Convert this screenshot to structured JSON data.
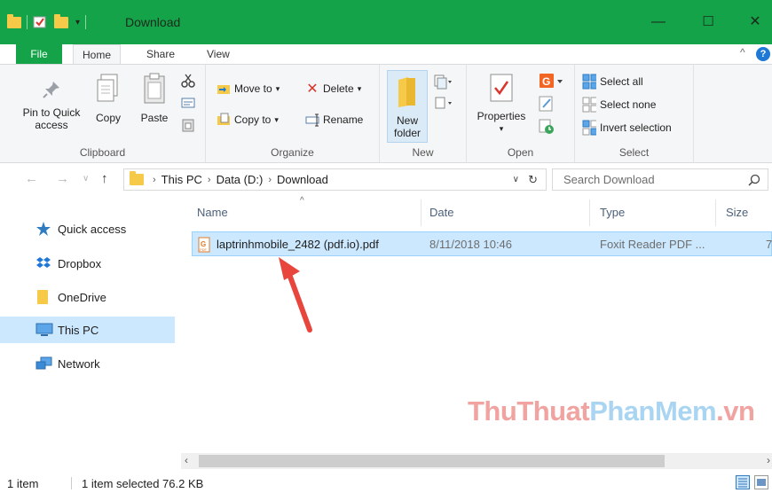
{
  "window": {
    "title": "Download",
    "minimize": "—",
    "maximize": "☐",
    "close": "✕"
  },
  "ribbon_tabs": [
    "File",
    "Home",
    "Share",
    "View"
  ],
  "ribbon_controls": {
    "collapse": "^",
    "help": "?"
  },
  "clipboard": {
    "pin_label_1": "Pin to Quick",
    "pin_label_2": "access",
    "copy": "Copy",
    "paste": "Paste",
    "group": "Clipboard"
  },
  "organize": {
    "move_to": "Move to",
    "copy_to": "Copy to",
    "delete": "Delete",
    "rename": "Rename",
    "group": "Organize"
  },
  "new": {
    "folder_1": "New",
    "folder_2": "folder",
    "group": "New"
  },
  "open": {
    "properties": "Properties",
    "group": "Open"
  },
  "select": {
    "select_all": "Select all",
    "select_none": "Select none",
    "invert": "Invert selection",
    "group": "Select"
  },
  "address": {
    "crumbs": [
      "This PC",
      "Data (D:)",
      "Download"
    ],
    "search_placeholder": "Search Download"
  },
  "nav": [
    {
      "label": "Quick access",
      "icon": "star-icon"
    },
    {
      "label": "Dropbox",
      "icon": "dropbox-icon"
    },
    {
      "label": "OneDrive",
      "icon": "folder-icon"
    },
    {
      "label": "This PC",
      "icon": "computer-icon",
      "selected": true
    },
    {
      "label": "Network",
      "icon": "network-icon"
    }
  ],
  "columns": [
    "Name",
    "Date",
    "Type",
    "Size"
  ],
  "files": [
    {
      "name": "laptrinhmobile_2482 (pdf.io).pdf",
      "date": "8/11/2018 10:46",
      "type": "Foxit Reader PDF ...",
      "size": "7"
    }
  ],
  "watermark": {
    "part1": "ThuThuat",
    "part2": "PhanMem",
    "part3": ".vn"
  },
  "status": {
    "items": "1 item",
    "selected": "1 item selected  76.2 KB"
  },
  "colors": {
    "title_bar": "#15a34a",
    "selection": "#cce8ff",
    "arrow": "#e8453c"
  }
}
